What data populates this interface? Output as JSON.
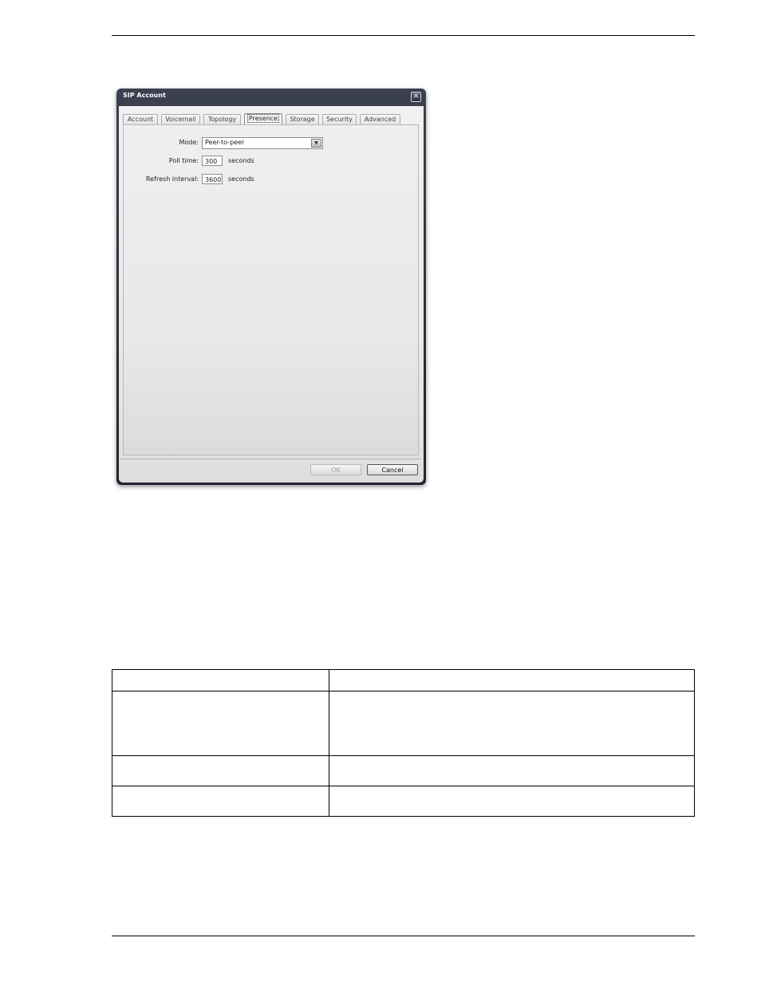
{
  "dialog": {
    "title": "SIP Account",
    "close_glyph": "✕",
    "tabs": [
      {
        "label": "Account"
      },
      {
        "label": "Voicemail"
      },
      {
        "label": "Topology"
      },
      {
        "label": "Presence"
      },
      {
        "label": "Storage"
      },
      {
        "label": "Security"
      },
      {
        "label": "Advanced"
      }
    ],
    "active_tab": "Presence",
    "fields": {
      "mode_label": "Mode:",
      "mode_value": "Peer-to-peer",
      "poll_label": "Poll time:",
      "poll_value": "300",
      "poll_unit": "seconds",
      "refresh_label": "Refresh interval:",
      "refresh_value": "3600",
      "refresh_unit": "seconds"
    },
    "buttons": {
      "ok": "OK",
      "cancel": "Cancel"
    },
    "icons": {
      "close": "close-icon",
      "dropdown": "chevron-down-icon"
    }
  }
}
